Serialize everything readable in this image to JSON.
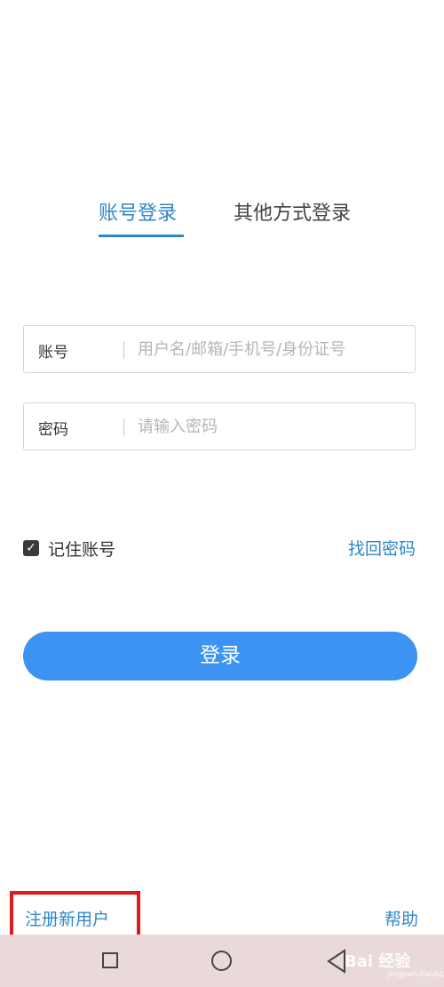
{
  "tabs": {
    "active_label": "账号登录",
    "other_label": "其他方式登录"
  },
  "form": {
    "account": {
      "label": "账号",
      "placeholder": "用户名/邮箱/手机号/身份证号"
    },
    "password": {
      "label": "密码",
      "placeholder": "请输入密码"
    }
  },
  "remember": {
    "label": "记住账号",
    "checked": true,
    "check_glyph": "✓"
  },
  "forgot_label": "找回密码",
  "login_button_label": "登录",
  "footer": {
    "register_label": "注册新用户",
    "help_label": "帮助"
  },
  "watermark": {
    "text": "Bai 经验",
    "sub": "jingyan.baidu.com"
  },
  "colors": {
    "accent": "#2f87c7",
    "button": "#3d93f2",
    "highlight": "#e2191b",
    "navbar": "#ead9db"
  },
  "icons": {
    "nav_recent": "square-icon",
    "nav_home": "circle-icon",
    "nav_back": "triangle-back-icon"
  }
}
